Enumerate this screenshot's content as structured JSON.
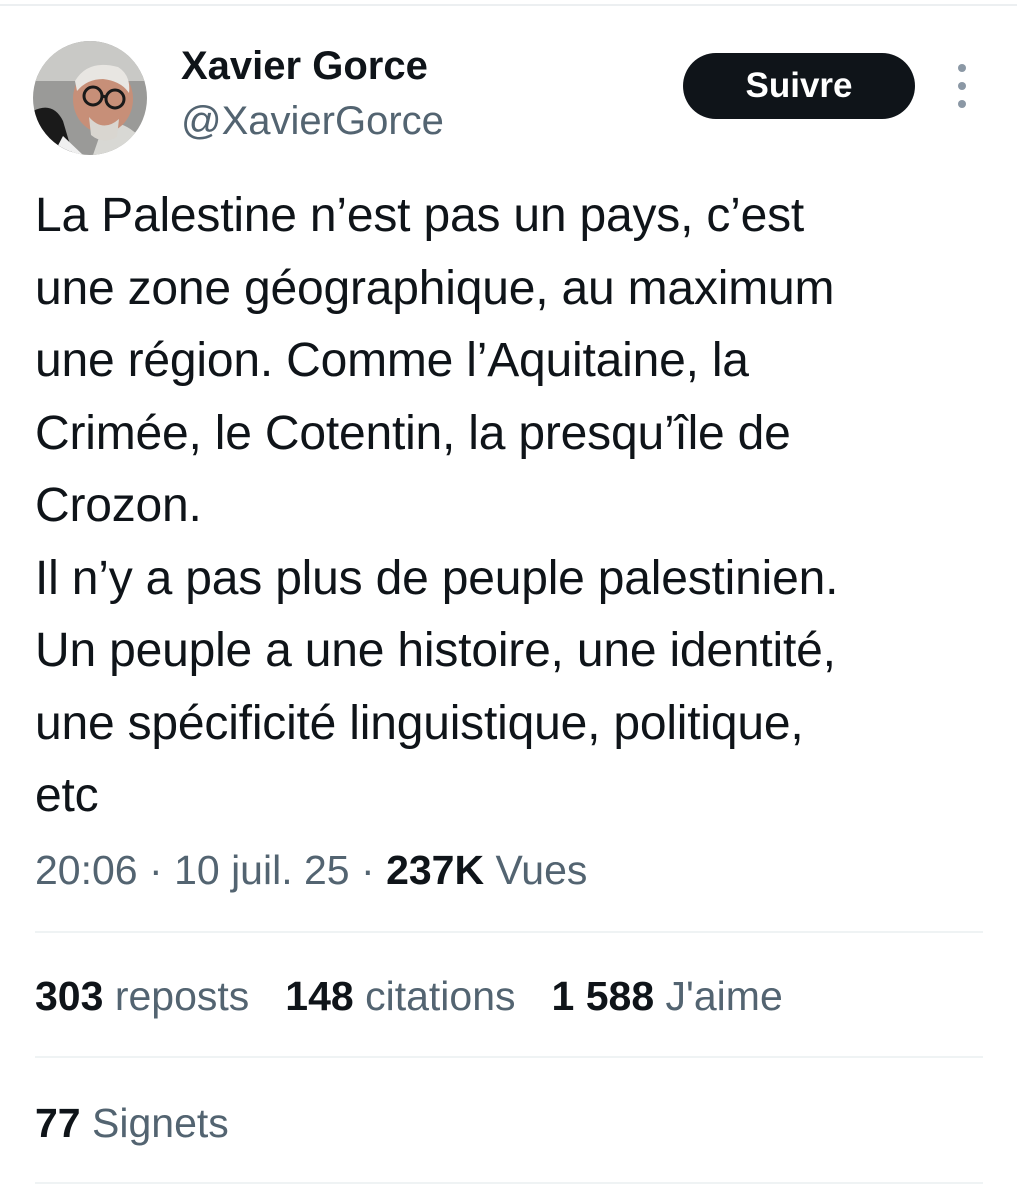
{
  "author": {
    "display_name": "Xavier Gorce",
    "handle": "@XavierGorce"
  },
  "follow_button": {
    "label": "Suivre"
  },
  "more_menu": {
    "icon": "more-vertical-icon"
  },
  "tweet": {
    "lines": [
      "La Palestine n’est pas un pays, c’est",
      "une zone géographique, au maximum",
      "une région. Comme l’Aquitaine, la",
      "Crimée, le Cotentin, la presqu’île de",
      "Crozon.",
      "Il n’y a pas plus de peuple palestinien.",
      "Un peuple a une histoire, une identité,",
      "une spécificité linguistique, politique,",
      "etc"
    ]
  },
  "meta": {
    "time": "20:06",
    "separator": "·",
    "date": "10 juil. 25",
    "views_count": "237K",
    "views_label": "Vues"
  },
  "stats": {
    "reposts_count": "303",
    "reposts_label": "reposts",
    "quotes_count": "148",
    "quotes_label": "citations",
    "likes_count": "1 588",
    "likes_label": "J'aime",
    "bookmarks_count": "77",
    "bookmarks_label": "Signets"
  },
  "colors": {
    "primary_text": "#0f1419",
    "secondary_text": "#536471",
    "divider": "#eff3f4",
    "button_bg": "#0f1419",
    "button_text": "#ffffff"
  }
}
